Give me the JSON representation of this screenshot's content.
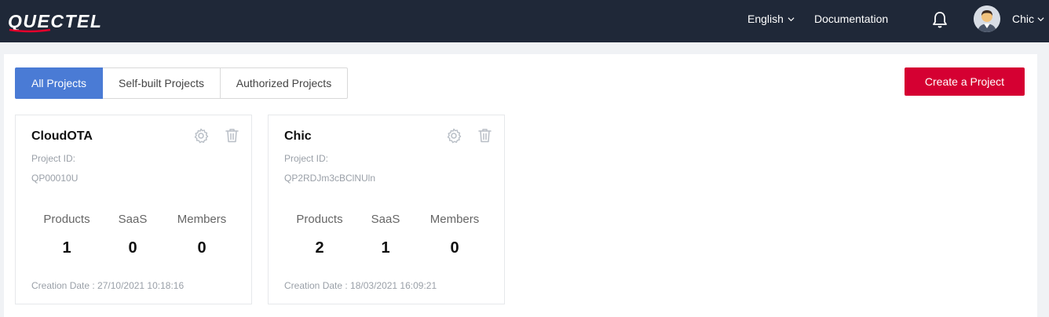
{
  "header": {
    "logo_text": "QUECTEL",
    "language": "English",
    "documentation": "Documentation",
    "user_name": "Chic"
  },
  "tabs": [
    {
      "label": "All Projects",
      "active": true
    },
    {
      "label": "Self-built Projects",
      "active": false
    },
    {
      "label": "Authorized Projects",
      "active": false
    }
  ],
  "create_button": "Create a Project",
  "projects": [
    {
      "name": "CloudOTA",
      "id_label": "Project ID:",
      "id": "QP00010U",
      "products_label": "Products",
      "products": "1",
      "saas_label": "SaaS",
      "saas": "0",
      "members_label": "Members",
      "members": "0",
      "creation_date": "Creation Date : 27/10/2021 10:18:16"
    },
    {
      "name": "Chic",
      "id_label": "Project ID:",
      "id": "QP2RDJm3cBClNUln",
      "products_label": "Products",
      "products": "2",
      "saas_label": "SaaS",
      "saas": "1",
      "members_label": "Members",
      "members": "0",
      "creation_date": "Creation Date : 18/03/2021 16:09:21"
    }
  ],
  "colors": {
    "header_bg": "#1f2838",
    "tab_active": "#4a7bd5",
    "create_button": "#d50032"
  },
  "icons": [
    "bell-icon",
    "gear-icon",
    "trash-icon",
    "chevron-down-icon",
    "avatar"
  ]
}
